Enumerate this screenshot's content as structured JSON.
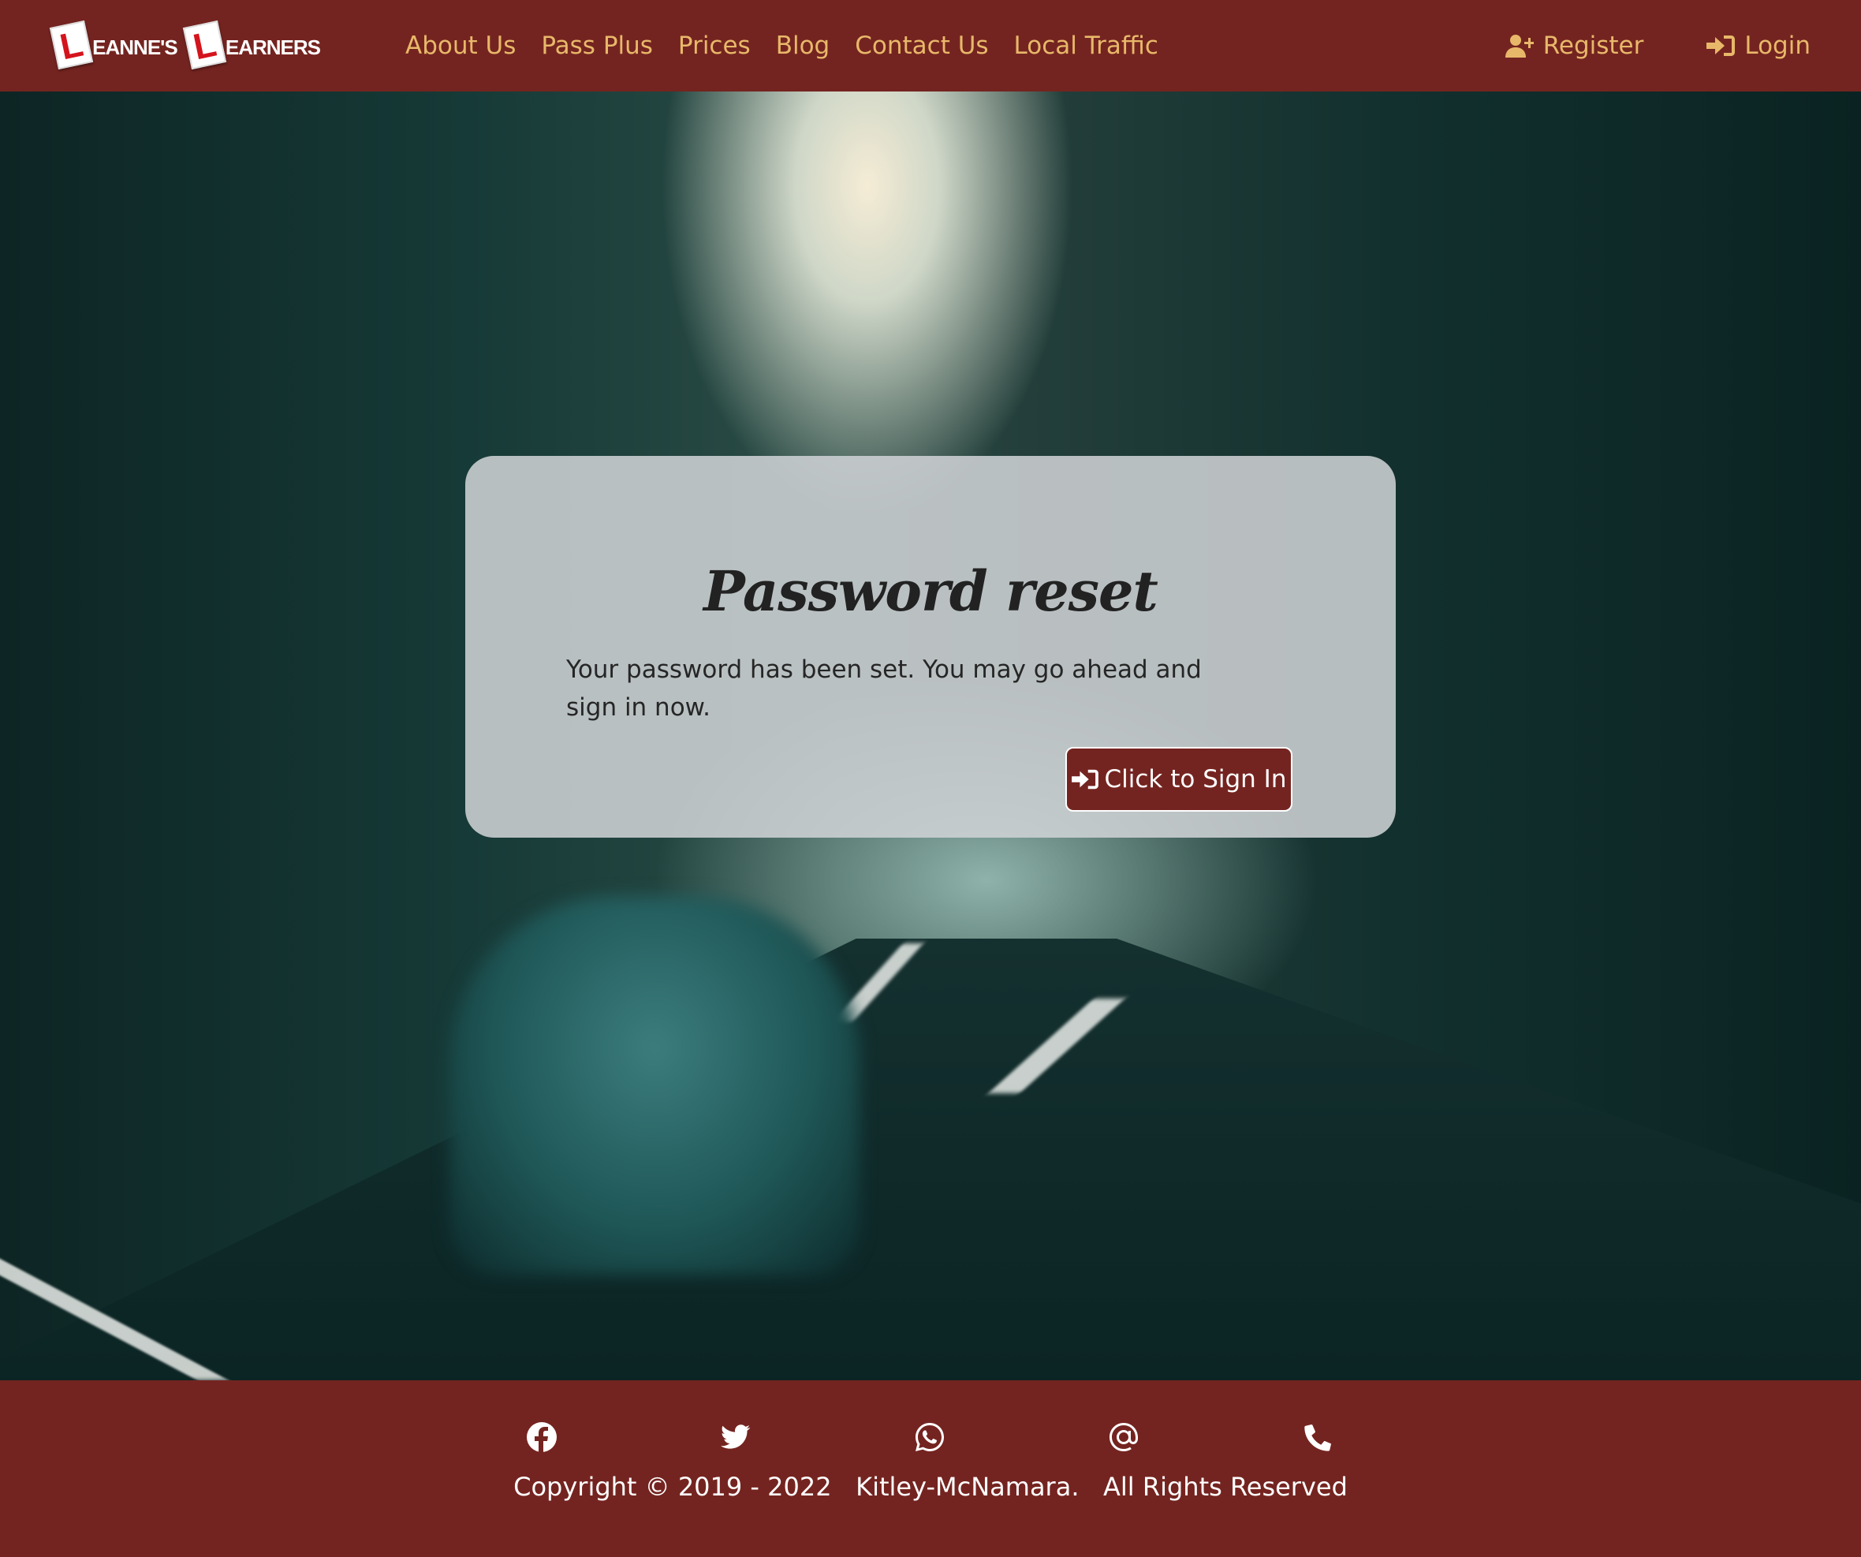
{
  "brand": {
    "name": "EANNE'S",
    "plate": "L",
    "name2": "EARNERS"
  },
  "nav": {
    "links": [
      "About Us",
      "Pass Plus",
      "Prices",
      "Blog",
      "Contact Us",
      "Local Traffic"
    ],
    "register": "Register",
    "login": "Login"
  },
  "card": {
    "title": "Password reset",
    "message": "Your password has been set. You may go ahead and sign in now.",
    "button": "Click to Sign In"
  },
  "footer": {
    "social_icons": [
      "facebook-icon",
      "twitter-icon",
      "whatsapp-icon",
      "at-icon",
      "phone-icon"
    ],
    "copyright": "Copyright © 2019 - 2022   Kitley-McNamara.   All Rights Reserved"
  },
  "colors": {
    "primary": "#742420",
    "nav_link": "#e8b86a",
    "card_bg": "#ced2d4"
  }
}
